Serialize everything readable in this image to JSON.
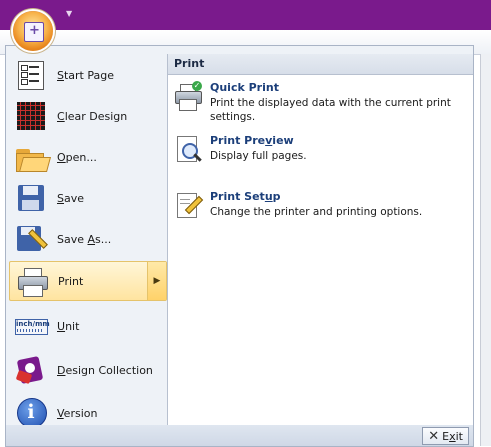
{
  "menu": {
    "items": [
      {
        "pre": "",
        "ul": "S",
        "post": "tart Page"
      },
      {
        "pre": "",
        "ul": "C",
        "post": "lear Design"
      },
      {
        "pre": "",
        "ul": "O",
        "post": "pen..."
      },
      {
        "pre": "",
        "ul": "S",
        "post": "ave"
      },
      {
        "pre": "Save ",
        "ul": "A",
        "post": "s..."
      },
      {
        "pre": "Print",
        "ul": "",
        "post": ""
      },
      {
        "pre": "",
        "ul": "U",
        "post": "nit"
      },
      {
        "pre": "",
        "ul": "D",
        "post": "esign Collection"
      },
      {
        "pre": "",
        "ul": "V",
        "post": "ersion"
      }
    ]
  },
  "print_panel": {
    "header": "Print",
    "items": [
      {
        "title_pre": "Quick Print",
        "title_ul": "",
        "title_post": "",
        "description": "Print the displayed data with the current print settings."
      },
      {
        "title_pre": "Print Pre",
        "title_ul": "v",
        "title_post": "iew",
        "description": "Display full pages."
      },
      {
        "title_pre": "Print Set",
        "title_ul": "u",
        "title_post": "p",
        "description": "Change the printer and printing options."
      }
    ]
  },
  "exit": {
    "pre": "E",
    "ul": "x",
    "post": "it"
  },
  "unit_icon_text": "inch/mm",
  "icons": {
    "office_button": "office-orb-icon",
    "start_page": "start-page-icon",
    "clear_design": "grid-icon",
    "open": "folder-open-icon",
    "save": "floppy-disk-icon",
    "save_as": "floppy-pencil-icon",
    "print": "printer-icon",
    "unit": "ruler-icon",
    "design_collection": "design-collection-icon",
    "version": "info-icon",
    "quick_print": "printer-check-icon",
    "print_preview": "magnifier-page-icon",
    "print_setup": "page-pencil-icon",
    "exit": "close-x-icon"
  },
  "colors": {
    "titlebar": "#7a1a8c",
    "accent_title": "#1c3f7a",
    "active_item": "#ffe4a0"
  }
}
